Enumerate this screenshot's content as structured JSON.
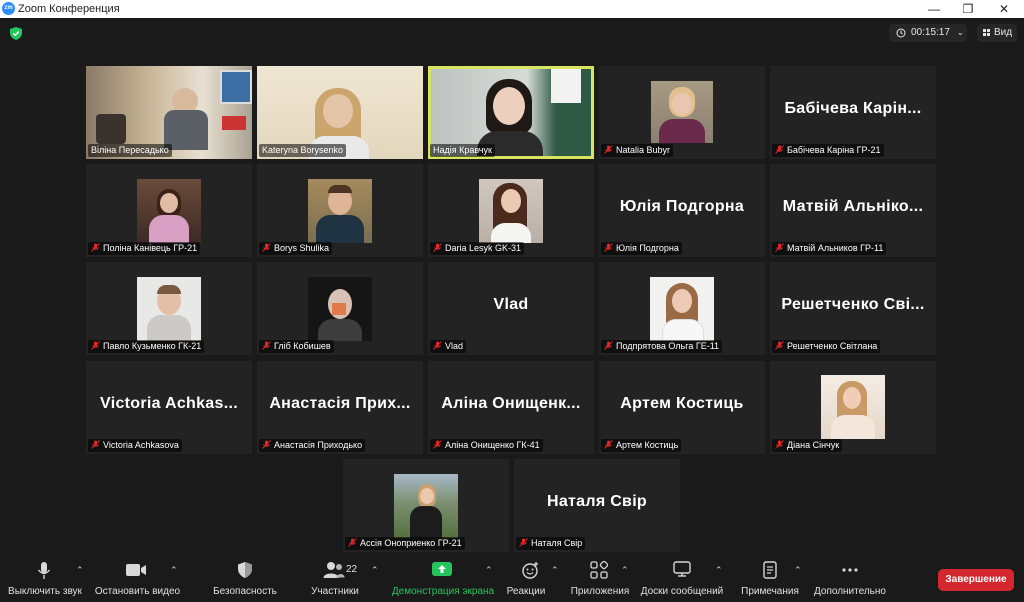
{
  "window": {
    "logo_text": "zm",
    "title": "Zoom Конференция"
  },
  "meeting": {
    "timer": "00:15:17",
    "view_label": "Вид"
  },
  "participants": [
    {
      "big": "",
      "label": "Віліна Пересадько",
      "muted": false,
      "video": true,
      "active": false
    },
    {
      "big": "",
      "label": "Kateryna Borysenko",
      "muted": false,
      "video": true,
      "active": false
    },
    {
      "big": "",
      "label": "Надія Кравчук",
      "muted": false,
      "video": true,
      "active": true
    },
    {
      "big": "",
      "label": "Natalia Bubyr",
      "muted": true,
      "video": true,
      "active": false
    },
    {
      "big": "Бабічева Карін...",
      "label": "Бабічева Каріна ГР-21",
      "muted": true,
      "video": false,
      "active": false
    },
    {
      "big": "",
      "label": "Поліна Канівець ГР-21",
      "muted": true,
      "video": true,
      "active": false
    },
    {
      "big": "",
      "label": "Borys Shulika",
      "muted": true,
      "video": true,
      "active": false
    },
    {
      "big": "",
      "label": "Daria Lesyk GK-31",
      "muted": true,
      "video": true,
      "active": false
    },
    {
      "big": "Юлія Подгорна",
      "label": "Юлія Подгорна",
      "muted": true,
      "video": false,
      "active": false
    },
    {
      "big": "Матвій Альніко...",
      "label": "Матвій Альников ГР-11",
      "muted": true,
      "video": false,
      "active": false
    },
    {
      "big": "",
      "label": "Павло Кузьменко ГК-21",
      "muted": true,
      "video": true,
      "active": false
    },
    {
      "big": "",
      "label": "Гліб Кобишев",
      "muted": true,
      "video": true,
      "active": false
    },
    {
      "big": "Vlad",
      "label": "Vlad",
      "muted": true,
      "video": false,
      "active": false
    },
    {
      "big": "",
      "label": "Подпрятова Ольга ГЕ-11",
      "muted": true,
      "video": true,
      "active": false
    },
    {
      "big": "Решетченко Сві...",
      "label": "Решетченко Світлана",
      "muted": true,
      "video": false,
      "active": false
    },
    {
      "big": "Victoria Achkas...",
      "label": "Victoria Achkasova",
      "muted": true,
      "video": false,
      "active": false
    },
    {
      "big": "Анастасія Прих...",
      "label": "Анастасія Приходько",
      "muted": true,
      "video": false,
      "active": false
    },
    {
      "big": "Аліна Онищенк...",
      "label": "Аліна Онищенко ГК-41",
      "muted": true,
      "video": false,
      "active": false
    },
    {
      "big": "Артем Костиць",
      "label": "Артем Костиць",
      "muted": true,
      "video": false,
      "active": false
    },
    {
      "big": "",
      "label": "Діана Сінчук",
      "muted": true,
      "video": true,
      "active": false
    },
    {
      "big": "",
      "label": "Ассія Оноприенко ГР-21",
      "muted": true,
      "video": true,
      "active": false
    },
    {
      "big": "Наталя Свір",
      "label": "Наталя Свір",
      "muted": true,
      "video": false,
      "active": false
    }
  ],
  "toolbar": {
    "mute_label": "Выключить звук",
    "video_label": "Остановить видео",
    "security_label": "Безопасность",
    "participants_count": "22",
    "participants_label": "Участники",
    "share_label": "Демонстрация экрана",
    "reactions_label": "Реакции",
    "apps_label": "Приложения",
    "whiteboards_label": "Доски сообщений",
    "notes_label": "Примечания",
    "more_label": "Дополнительно",
    "end_label": "Завершение"
  },
  "colors": {
    "background": "#1a1a1a",
    "tile": "#232323",
    "active_border": "#d7e560",
    "share_green": "#22c55e",
    "end_red": "#d4282e",
    "mute_red": "#e02828"
  },
  "icons": [
    "shield-check-icon",
    "clock-icon",
    "grid-icon",
    "microphone-icon",
    "video-camera-icon",
    "shield-icon",
    "people-icon",
    "share-screen-icon",
    "emoji-icon",
    "apps-icon",
    "whiteboard-icon",
    "notes-icon",
    "more-icon"
  ]
}
